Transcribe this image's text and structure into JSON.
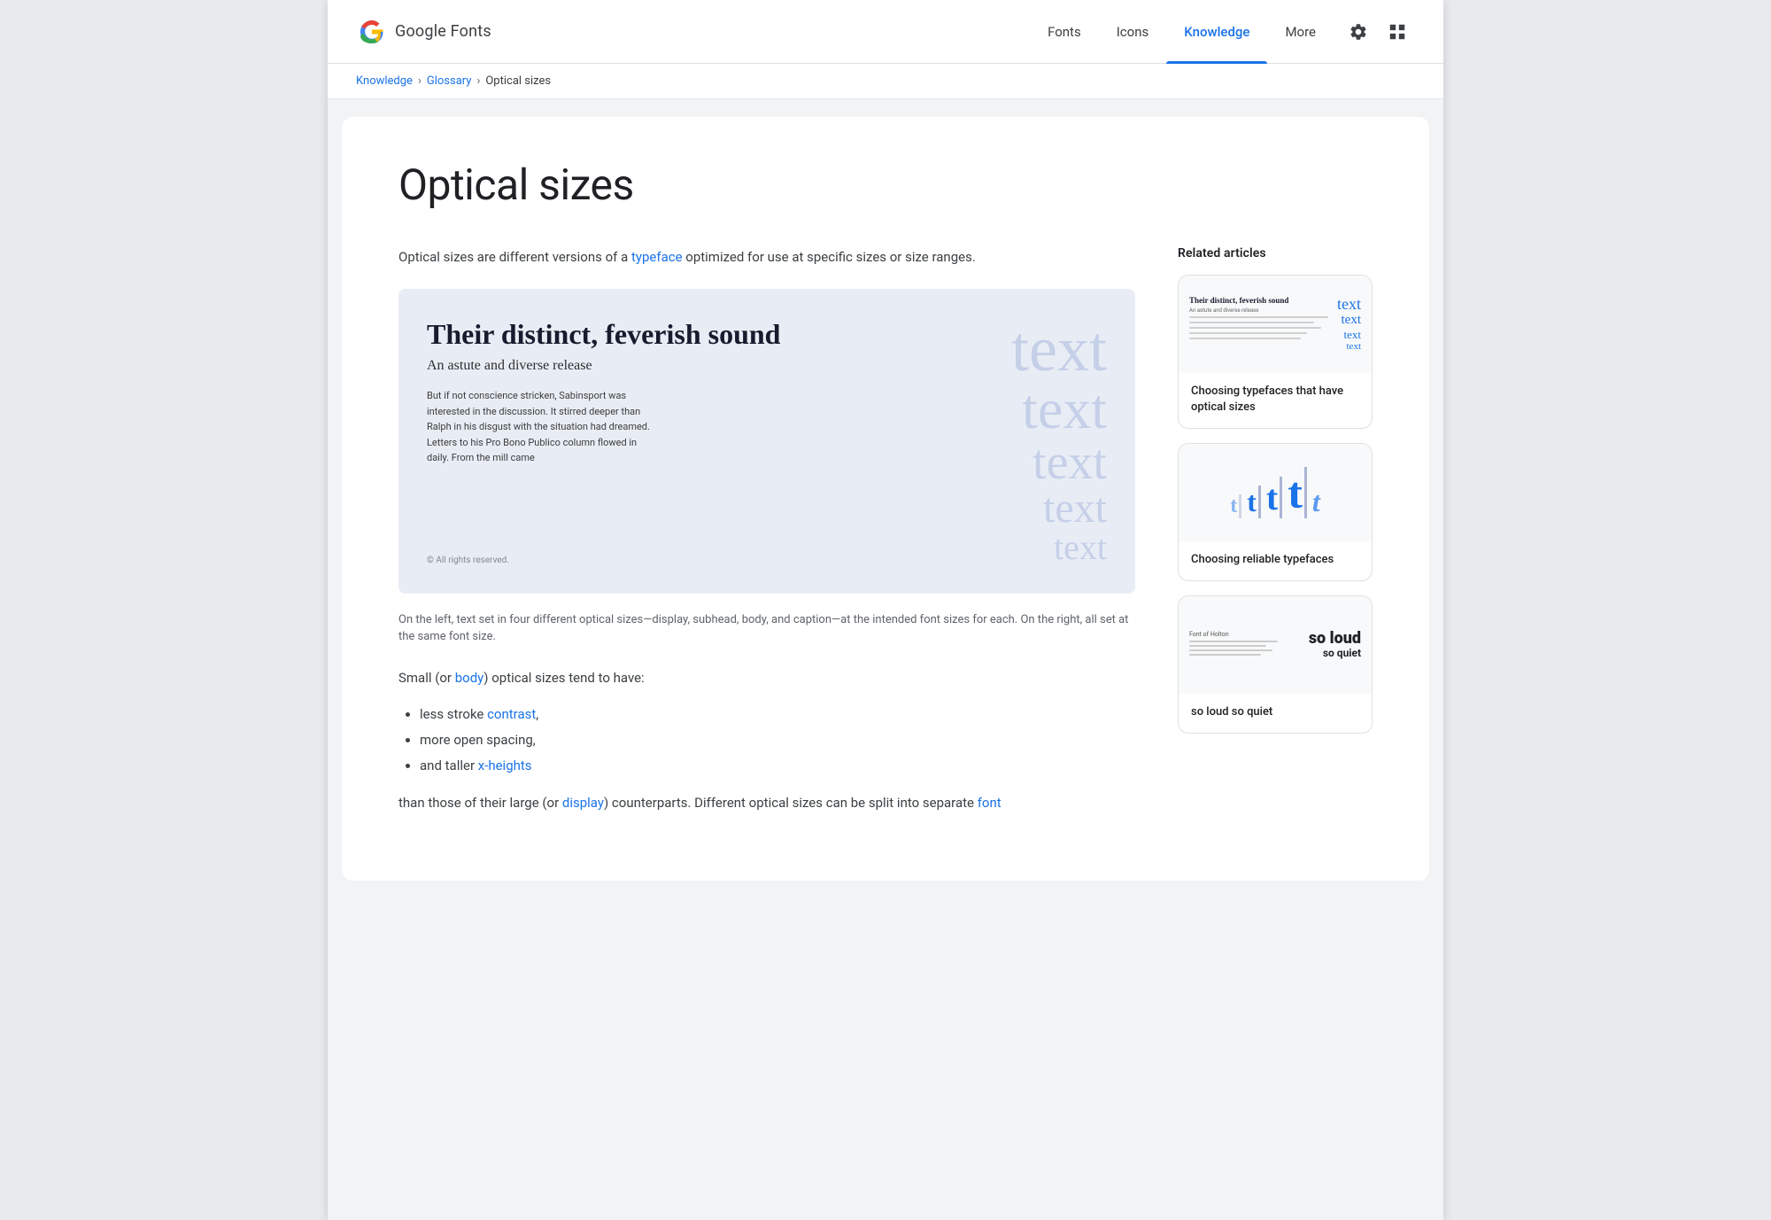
{
  "header": {
    "logo_text": "Google Fonts",
    "nav_items": [
      {
        "label": "Fonts",
        "active": false
      },
      {
        "label": "Icons",
        "active": false
      },
      {
        "label": "Knowledge",
        "active": true
      },
      {
        "label": "More",
        "active": false
      }
    ]
  },
  "breadcrumb": {
    "items": [
      {
        "label": "Knowledge",
        "link": true
      },
      {
        "separator": ">"
      },
      {
        "label": "Glossary",
        "link": true
      },
      {
        "separator": ">"
      },
      {
        "label": "Optical sizes",
        "link": false
      }
    ]
  },
  "page": {
    "title": "Optical sizes",
    "intro": "Optical sizes are different versions of a ",
    "intro_link": "typeface",
    "intro_suffix": " optimized for use at specific sizes or size ranges.",
    "demo_heading": "Their distinct, feverish sound",
    "demo_subheading": "An astute and diverse release",
    "demo_body": "But if not conscience stricken, Sabinsport was interested in the discussion. It stirred deeper than Ralph in his disgust with the situation had dreamed. Letters to his Pro Bono Publico column flowed in daily. From the mill came",
    "demo_copyright": "© All rights reserved.",
    "demo_right_texts": [
      "text",
      "text",
      "text",
      "text",
      "text"
    ],
    "caption": "On the left, text set in four different optical sizes—display, subhead, body, and caption—at the intended font sizes for each. On the right, all set at the same font size.",
    "body1_prefix": "Small (or ",
    "body1_link": "body",
    "body1_suffix": ") optical sizes tend to have:",
    "bullet1": "less stroke ",
    "bullet1_link": "contrast",
    "bullet1_suffix": ",",
    "bullet2": "more open spacing,",
    "bullet3_prefix": "and taller ",
    "bullet3_link": "x-heights",
    "body2_prefix": "than those of their large (or ",
    "body2_link": "display",
    "body2_suffix": ") counterparts. Different optical sizes can be split into separate ",
    "body2_link2": "font"
  },
  "sidebar": {
    "heading": "Related articles",
    "articles": [
      {
        "title": "Choosing typefaces that have optical sizes"
      },
      {
        "title": "Choosing reliable typefaces"
      },
      {
        "title": "so loud so quiet"
      }
    ]
  }
}
